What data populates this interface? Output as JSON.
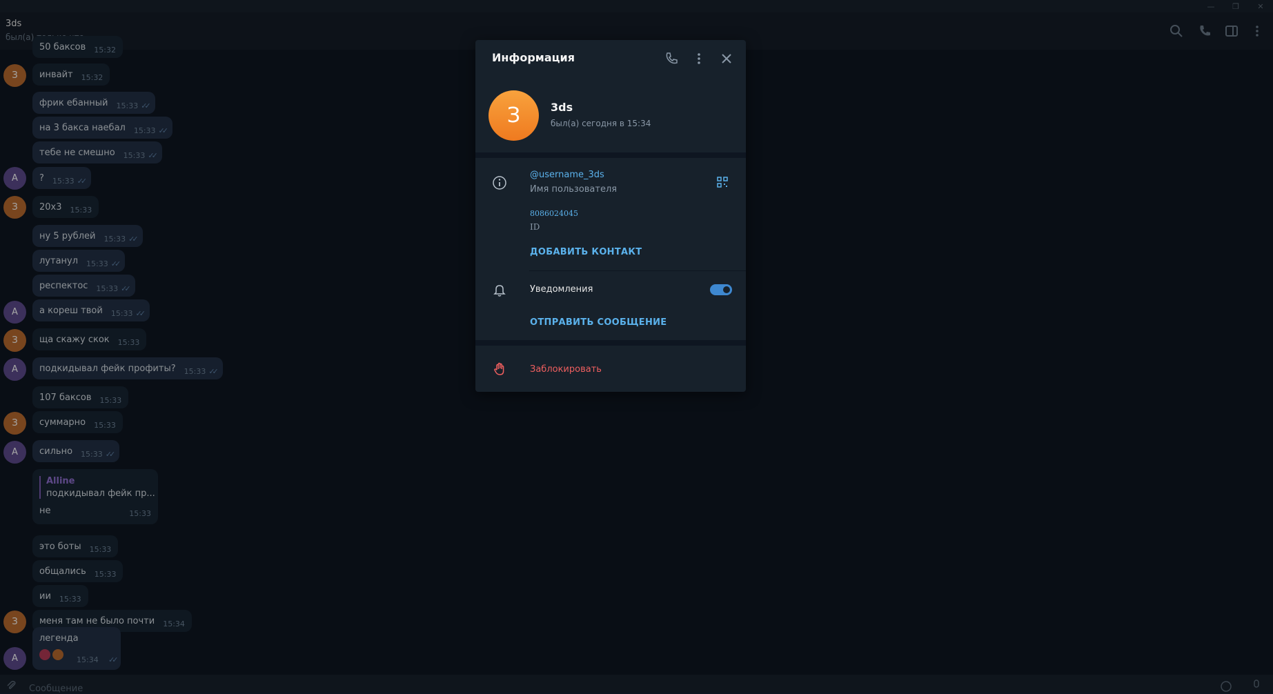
{
  "chat": {
    "title": "3ds",
    "status": "был(а) только что",
    "composer_placeholder": "Сообщение"
  },
  "messages": [
    {
      "text": "50 баксов",
      "time": "15:32",
      "out": false,
      "avatar": ""
    },
    {
      "text": "инвайт",
      "time": "15:32",
      "out": false,
      "avatar": "З"
    },
    {
      "text": "фрик ебанный",
      "time": "15:33",
      "out": true,
      "avatar": ""
    },
    {
      "text": "на 3 бакса наебал",
      "time": "15:33",
      "out": true,
      "avatar": ""
    },
    {
      "text": "тебе не смешно",
      "time": "15:33",
      "out": true,
      "avatar": ""
    },
    {
      "text": "?",
      "time": "15:33",
      "out": true,
      "avatar": "A"
    },
    {
      "text": "20х3",
      "time": "15:33",
      "out": false,
      "avatar": "З"
    },
    {
      "text": "ну 5 рублей",
      "time": "15:33",
      "out": true,
      "avatar": ""
    },
    {
      "text": "лутанул",
      "time": "15:33",
      "out": true,
      "avatar": ""
    },
    {
      "text": "респектос",
      "time": "15:33",
      "out": true,
      "avatar": ""
    },
    {
      "text": "а кореш твой",
      "time": "15:33",
      "out": true,
      "avatar": "A"
    },
    {
      "text": "ща скажу скок",
      "time": "15:33",
      "out": false,
      "avatar": "З"
    },
    {
      "text": "подкидывал фейк профиты?",
      "time": "15:33",
      "out": true,
      "avatar": "A"
    },
    {
      "text": "107 баксов",
      "time": "15:33",
      "out": false,
      "avatar": ""
    },
    {
      "text": "суммарно",
      "time": "15:33",
      "out": false,
      "avatar": "З"
    },
    {
      "text": "сильно",
      "time": "15:33",
      "out": true,
      "avatar": "A"
    },
    {
      "text": "это боты",
      "time": "15:33",
      "out": false,
      "avatar": ""
    },
    {
      "text": "общались",
      "time": "15:33",
      "out": false,
      "avatar": ""
    },
    {
      "text": "ии",
      "time": "15:33",
      "out": false,
      "avatar": ""
    },
    {
      "text": "меня там не было почти",
      "time": "15:34",
      "out": false,
      "avatar": "З"
    },
    {
      "text": "легенда",
      "time": "15:34",
      "out": true,
      "avatar": "A"
    }
  ],
  "reply": {
    "author": "Alline",
    "quote": "подкидывал фейк пр...",
    "text": "не",
    "time": "15:33"
  },
  "panel": {
    "title": "Информация",
    "avatar_letter": "З",
    "name": "3ds",
    "status": "был(а) сегодня в 15:34",
    "username": "@username_3ds",
    "username_label": "Имя пользователя",
    "id_value": "8086024045",
    "id_label": "ID",
    "add_contact": "ДОБАВИТЬ КОНТАКТ",
    "notifications": "Уведомления",
    "notifications_on": true,
    "send_message": "ОТПРАВИТЬ СООБЩЕНИЕ",
    "block": "Заблокировать"
  },
  "colors": {
    "accent": "#5bb2ec",
    "danger": "#ef5f5f",
    "avatar_orange": "#f8a23d",
    "toggle": "#3e88d0"
  }
}
